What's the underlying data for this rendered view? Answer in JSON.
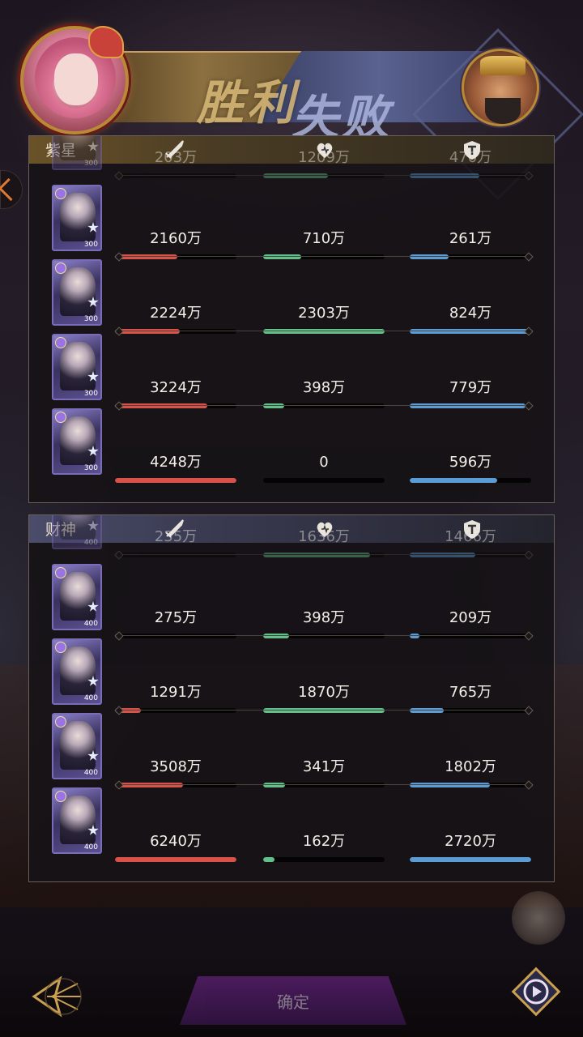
{
  "header": {
    "win_label": "胜利",
    "lose_label": "失败"
  },
  "teams": [
    {
      "name": "紫星",
      "heroes": [
        {
          "damage": "203万",
          "heal": "1209万",
          "tank": "470万",
          "damage_pct": 4,
          "heal_pct": 53,
          "tank_pct": 57,
          "level": "300",
          "partial": true
        },
        {
          "damage": "2160万",
          "heal": "710万",
          "tank": "261万",
          "damage_pct": 51,
          "heal_pct": 31,
          "tank_pct": 32,
          "level": "300"
        },
        {
          "damage": "2224万",
          "heal": "2303万",
          "tank": "824万",
          "damage_pct": 53,
          "heal_pct": 100,
          "tank_pct": 100,
          "level": "300"
        },
        {
          "damage": "3224万",
          "heal": "398万",
          "tank": "779万",
          "damage_pct": 76,
          "heal_pct": 17,
          "tank_pct": 95,
          "level": "300"
        },
        {
          "damage": "4248万",
          "heal": "0",
          "tank": "596万",
          "damage_pct": 100,
          "heal_pct": 0,
          "tank_pct": 72,
          "level": "300"
        }
      ]
    },
    {
      "name": "财神",
      "heroes": [
        {
          "damage": "235万",
          "heal": "1636万",
          "tank": "1466万",
          "damage_pct": 4,
          "heal_pct": 88,
          "tank_pct": 54,
          "level": "400",
          "partial": true
        },
        {
          "damage": "275万",
          "heal": "398万",
          "tank": "209万",
          "damage_pct": 4,
          "heal_pct": 21,
          "tank_pct": 8,
          "level": "400"
        },
        {
          "damage": "1291万",
          "heal": "1870万",
          "tank": "765万",
          "damage_pct": 21,
          "heal_pct": 100,
          "tank_pct": 28,
          "level": "400"
        },
        {
          "damage": "3508万",
          "heal": "341万",
          "tank": "1802万",
          "damage_pct": 56,
          "heal_pct": 18,
          "tank_pct": 66,
          "level": "400"
        },
        {
          "damage": "6240万",
          "heal": "162万",
          "tank": "2720万",
          "damage_pct": 100,
          "heal_pct": 9,
          "tank_pct": 100,
          "level": "400"
        }
      ]
    }
  ],
  "footer": {
    "confirm_label": "确定"
  },
  "icons": {
    "damage": "sword-icon",
    "heal": "heart-icon",
    "tank": "shield-icon",
    "back": "back-arrow-icon",
    "replay": "replay-icon"
  },
  "colors": {
    "damage": "#d9524a",
    "heal": "#62c08a",
    "tank": "#5c9cd4",
    "win_gold": "#d7b878",
    "lose_blue": "#aab4dc"
  }
}
